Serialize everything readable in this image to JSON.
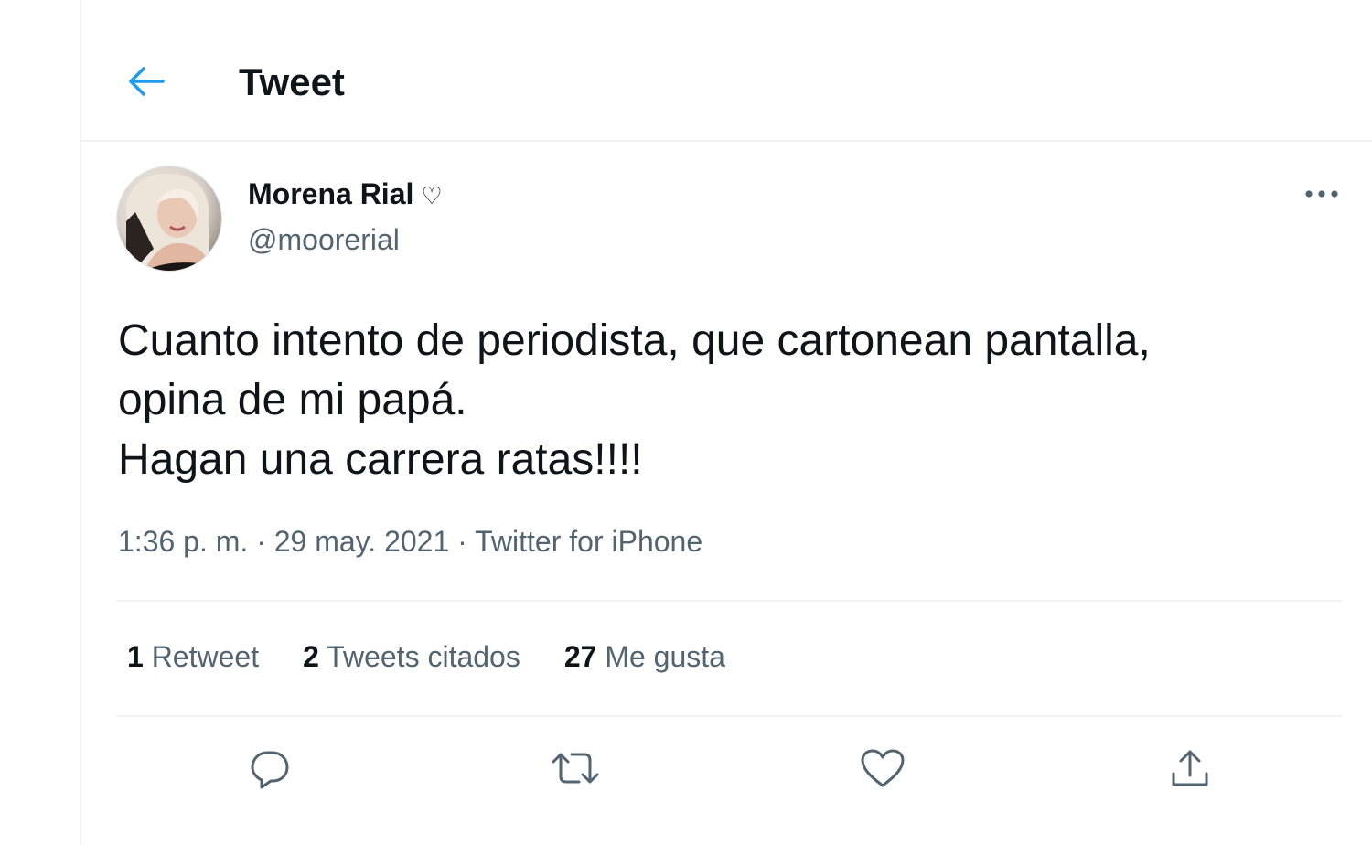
{
  "header": {
    "title": "Tweet",
    "back_icon": "arrow-left-icon",
    "accent_color": "#1d9bf0"
  },
  "tweet": {
    "author": {
      "display_name": "Morena Rial",
      "name_emoji": "♡",
      "handle": "@moorerial"
    },
    "text_lines": [
      "Cuanto intento de periodista, que cartonean pantalla,",
      "opina de mi papá.",
      "Hagan una carrera ratas!!!!"
    ],
    "meta": {
      "time": "1:36 p. m.",
      "separator": " · ",
      "date": "29 may. 2021",
      "source": "Twitter for iPhone"
    },
    "stats": [
      {
        "count": "1",
        "label": "Retweet"
      },
      {
        "count": "2",
        "label": "Tweets citados"
      },
      {
        "count": "27",
        "label": "Me gusta"
      }
    ],
    "actions": [
      {
        "name": "reply",
        "icon": "reply-icon"
      },
      {
        "name": "retweet",
        "icon": "retweet-icon"
      },
      {
        "name": "like",
        "icon": "heart-icon"
      },
      {
        "name": "share",
        "icon": "share-icon"
      }
    ]
  },
  "colors": {
    "text_primary": "#0f1419",
    "text_secondary": "#536471",
    "divider": "#eff3f4"
  }
}
